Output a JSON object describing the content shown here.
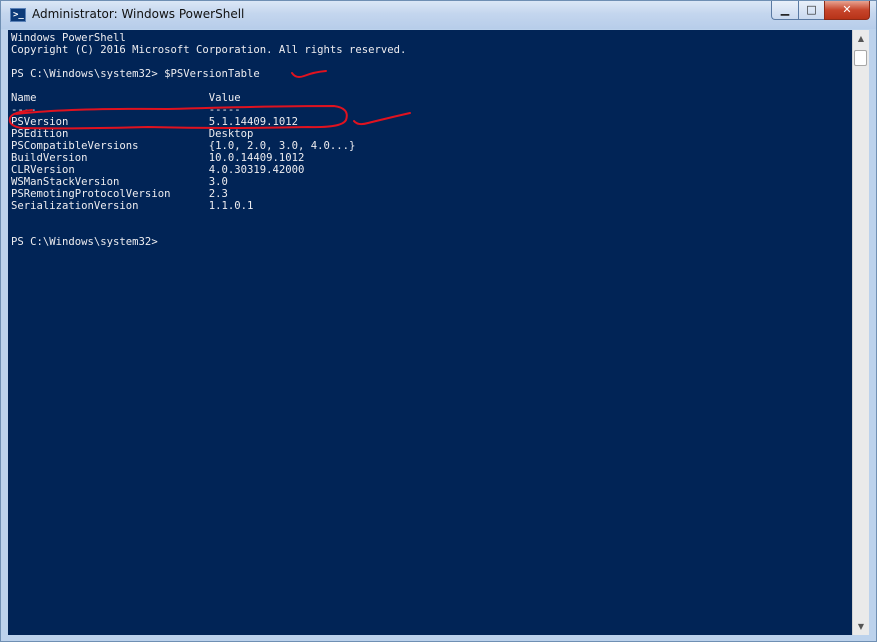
{
  "window": {
    "title": "Administrator: Windows PowerShell",
    "icon": "powershell-icon",
    "icon_glyph": ">_",
    "controls": {
      "minimize": "minimize-icon",
      "minimize_glyph": "▁",
      "maximize": "maximize-icon",
      "maximize_glyph": "□",
      "close": "close-icon",
      "close_glyph": "✕"
    }
  },
  "console": {
    "background_color": "#012456",
    "text_color": "#eeedf0",
    "annotation_color": "#e0121f",
    "banner": [
      "Windows PowerShell",
      "Copyright (C) 2016 Microsoft Corporation. All rights reserved."
    ],
    "prompt_command": "PS C:\\Windows\\system32> $PSVersionTable",
    "table_header": "Name                           Value",
    "table_separator": "----                           -----",
    "rows": [
      "PSVersion                      5.1.14409.1012",
      "PSEdition                      Desktop",
      "PSCompatibleVersions           {1.0, 2.0, 3.0, 4.0...}",
      "BuildVersion                   10.0.14409.1012",
      "CLRVersion                     4.0.30319.42000",
      "WSManStackVersion              3.0",
      "PSRemotingProtocolVersion      2.3",
      "SerializationVersion           1.1.0.1"
    ],
    "final_prompt": "PS C:\\Windows\\system32>"
  },
  "scrollbar": {
    "up_icon": "scroll-up-arrow-icon",
    "up_glyph": "▲",
    "down_icon": "scroll-down-arrow-icon",
    "down_glyph": "▼"
  }
}
